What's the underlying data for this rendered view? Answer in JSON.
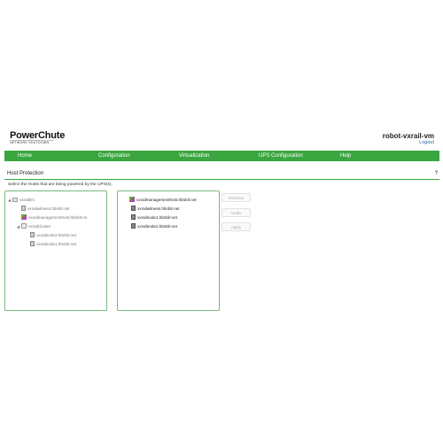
{
  "brand": {
    "title": "PowerChute",
    "subtitle": "NETWORK SHUTDOWN"
  },
  "header": {
    "hostname": "robot-vxrail-vm",
    "logout": "Logout"
  },
  "nav": {
    "items": [
      "Home",
      "Configuration",
      "Virtualization",
      "UPS Configuration",
      "Help"
    ]
  },
  "section": {
    "title": "Host Protection",
    "help": "?",
    "instruction": "Select the Hosts that are being powered by the UPS(s)."
  },
  "tree": {
    "items": [
      {
        "label": "vxrailDC",
        "icon": "datacenter-icon"
      },
      {
        "label": "vxrailwitness.hbnblr.net",
        "icon": "vm-icon"
      },
      {
        "label": "vxrailmanagementhost.hbnblr.ne",
        "icon": "management-vm-icon"
      },
      {
        "label": "vxrailCluster",
        "icon": "cluster-icon"
      },
      {
        "label": "vxrailnode2.hbnblr.net",
        "icon": "vm-icon"
      },
      {
        "label": "vxrailnode1.hbnblr.net",
        "icon": "vm-icon"
      }
    ]
  },
  "selected": {
    "items": [
      {
        "label": "vxrailmanagementhost.hbnblr.net",
        "icon": "management-vm-icon"
      },
      {
        "label": "vxrailwitness.hbnblr.net",
        "icon": "host-icon"
      },
      {
        "label": "vxrailnode1.hbnblr.net",
        "icon": "host-icon"
      },
      {
        "label": "vxrailnode2.hbnblr.net",
        "icon": "host-icon"
      }
    ]
  },
  "buttons": {
    "remove": "Remove",
    "undo": "Undo",
    "apply": "Apply"
  },
  "colors": {
    "accent": "#3aa640",
    "panel_border": "#79b87d",
    "link": "#2a5db0"
  }
}
